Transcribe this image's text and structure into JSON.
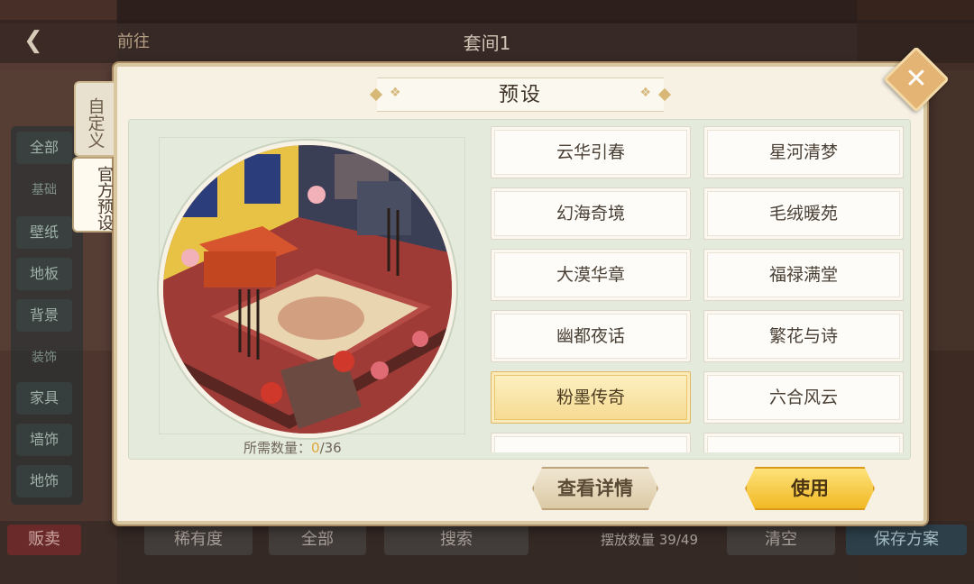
{
  "background": {
    "title": "套间1",
    "nav_label": "前往",
    "sidebar": {
      "items": [
        "全部",
        "壁纸",
        "地板",
        "背景",
        "家具",
        "墙饰",
        "地饰"
      ],
      "sections": [
        "基础",
        "装饰"
      ]
    },
    "bottom": {
      "sell": "贩卖",
      "rarity": "稀有度",
      "all": "全部",
      "search_placeholder": "搜索",
      "count": "摆放数量 39/49",
      "clear": "清空",
      "save": "保存方案"
    }
  },
  "modal": {
    "title": "预设",
    "tabs": [
      {
        "label": "自定义"
      },
      {
        "label": "官方预设"
      }
    ],
    "preview": {
      "count_label": "所需数量：",
      "count_current": "0",
      "count_total": "/36"
    },
    "options": [
      {
        "label": "云华引春",
        "selected": false
      },
      {
        "label": "星河清梦",
        "selected": false
      },
      {
        "label": "幻海奇境",
        "selected": false
      },
      {
        "label": "毛绒暖苑",
        "selected": false
      },
      {
        "label": "大漠华章",
        "selected": false
      },
      {
        "label": "福禄满堂",
        "selected": false
      },
      {
        "label": "幽都夜话",
        "selected": false
      },
      {
        "label": "繁花与诗",
        "selected": false
      },
      {
        "label": "粉墨传奇",
        "selected": true
      },
      {
        "label": "六合风云",
        "selected": false
      },
      {
        "label": "",
        "selected": false
      },
      {
        "label": "",
        "selected": false
      }
    ],
    "buttons": {
      "details": "查看详情",
      "use": "使用"
    }
  },
  "colors": {
    "accent_gold": "#f2b925",
    "panel_bg": "#f7f1e4",
    "selected_option": "#f5d98e"
  }
}
